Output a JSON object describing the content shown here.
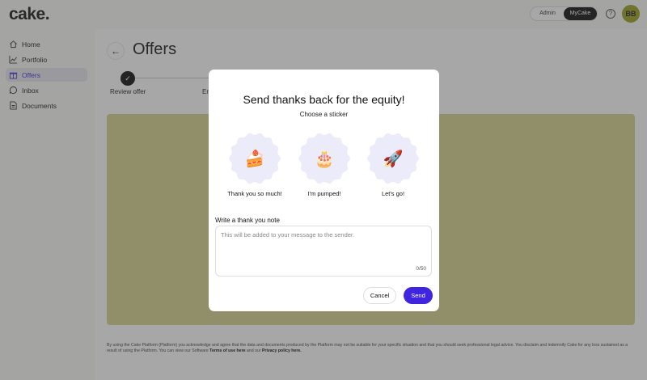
{
  "app": {
    "logo": "cake.",
    "switch": {
      "admin": "Admin",
      "mycake": "MyCake"
    },
    "help_icon": "?",
    "avatar_initials": "BB",
    "accent_color": "#3f24e0",
    "avatar_color": "#9aa11f"
  },
  "sidebar": {
    "items": [
      {
        "label": "Home",
        "icon": "home-icon"
      },
      {
        "label": "Portfolio",
        "icon": "chart-icon"
      },
      {
        "label": "Offers",
        "icon": "gift-icon",
        "active": true
      },
      {
        "label": "Inbox",
        "icon": "chat-icon"
      },
      {
        "label": "Documents",
        "icon": "document-icon"
      }
    ]
  },
  "main": {
    "back_icon": "←",
    "title": "Offers",
    "steps": [
      {
        "label": "Review offer",
        "done": true,
        "check": "✓"
      },
      {
        "label": "Er"
      }
    ],
    "legal_text_1": "By using the Cake Platform (Platform) you acknowledge and agree that the data and documents produced by the Platform may not be suitable for your specific situation and that you should seek professional legal advice. You disclaim and indemnify Cake for any loss sustained as a result of using the Platform. You can view our Software ",
    "legal_link_terms": "Terms of use here",
    "legal_text_2": " and our ",
    "legal_link_privacy": "Privacy policy here."
  },
  "modal": {
    "title": "Send thanks back for the equity!",
    "subtitle": "Choose a sticker",
    "stickers": [
      {
        "emoji": "🍰",
        "label": "Thank you so much!"
      },
      {
        "emoji": "🎂",
        "label": "I'm pumped!"
      },
      {
        "emoji": "🚀",
        "label": "Let's go!"
      }
    ],
    "note_label": "Write a thank you note",
    "note_placeholder": "This will be added to your message to the sender.",
    "note_value": "",
    "counter": "0/50",
    "cancel_label": "Cancel",
    "send_label": "Send"
  }
}
